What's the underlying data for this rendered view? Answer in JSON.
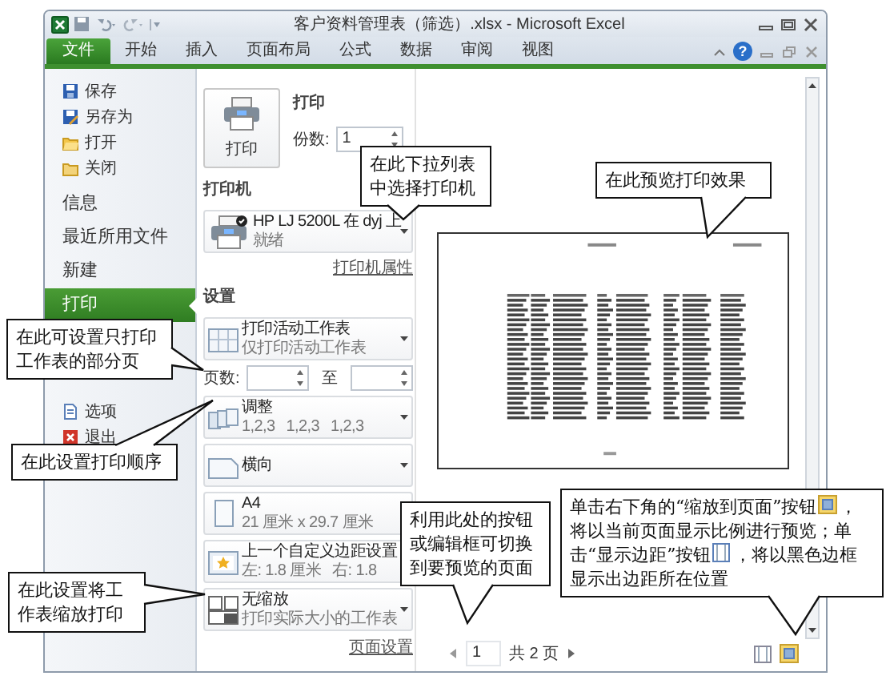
{
  "window": {
    "title": "客户资料管理表（筛选）.xlsx - Microsoft Excel"
  },
  "ribbon": {
    "tabs": [
      {
        "label": "文件",
        "selected": true
      },
      {
        "label": "开始",
        "selected": false
      },
      {
        "label": "插入",
        "selected": false
      },
      {
        "label": "页面布局",
        "selected": false
      },
      {
        "label": "公式",
        "selected": false
      },
      {
        "label": "数据",
        "selected": false
      },
      {
        "label": "审阅",
        "selected": false
      },
      {
        "label": "视图",
        "selected": false
      }
    ],
    "help": "?"
  },
  "sidebar": {
    "groups": [
      [
        {
          "label": "保存",
          "kind": "command",
          "selected": false
        },
        {
          "label": "另存为",
          "kind": "command",
          "selected": false
        },
        {
          "label": "打开",
          "kind": "command",
          "selected": false
        },
        {
          "label": "关闭",
          "kind": "command",
          "selected": false
        }
      ],
      [
        {
          "label": "信息",
          "kind": "section",
          "selected": false
        },
        {
          "label": "最近所用文件",
          "kind": "section",
          "selected": false
        },
        {
          "label": "新建",
          "kind": "section",
          "selected": false
        },
        {
          "label": "打印",
          "kind": "section",
          "selected": true
        }
      ],
      [
        {
          "label": "选项",
          "kind": "command",
          "selected": false
        },
        {
          "label": "退出",
          "kind": "command",
          "selected": false
        }
      ]
    ]
  },
  "print": {
    "button": "打印",
    "heading": "打印",
    "copies_label": "份数:",
    "copies": "1"
  },
  "printer": {
    "heading": "打印机",
    "name": "HP LJ 5200L 在 dyj 上",
    "status": "就绪",
    "properties_link": "打印机属性"
  },
  "settings": {
    "heading": "设置",
    "items": [
      {
        "kind": "dropdown",
        "title": "打印活动工作表",
        "subtitles": [
          "仅打印活动工作表"
        ]
      },
      {
        "kind": "range",
        "label": "页数:",
        "to_label": "至"
      },
      {
        "kind": "dropdown",
        "title": "调整",
        "subtitles": [
          "1,2,3",
          "1,2,3",
          "1,2,3"
        ]
      },
      {
        "kind": "dropdown",
        "title": "横向"
      },
      {
        "kind": "dropdown",
        "title": "A4",
        "subtitles": [
          "21 厘米 x 29.7 厘米"
        ]
      },
      {
        "kind": "dropdown",
        "title": "上一个自定义边距设置",
        "subtitles": [
          "左: 1.8 厘米",
          "右: 1.8"
        ]
      },
      {
        "kind": "dropdown",
        "title": "无缩放",
        "subtitles": [
          "打印实际大小的工作表"
        ]
      }
    ],
    "page_setup_link": "页面设置"
  },
  "preview": {
    "current_page": "1",
    "total": "共 2 页"
  },
  "callouts": [
    {
      "lines": [
        "在此下拉列表",
        "中选择打印机"
      ]
    },
    {
      "lines": [
        "在此预览打印效果"
      ]
    },
    {
      "lines": [
        "在此可设置只打印",
        "工作表的部分页"
      ]
    },
    {
      "lines": [
        "在此设置打印顺序"
      ]
    },
    {
      "lines": [
        "利用此处的按钮",
        "或编辑框可切换",
        "到要预览的页面"
      ]
    },
    {
      "parts": [
        {
          "kind": "text",
          "text": "单击右下角的“缩放到页面”按钮"
        },
        {
          "kind": "icon"
        },
        {
          "kind": "text",
          "text": "，将以当前页面显示比例进行预览；单击“显示边距”按钮"
        },
        {
          "kind": "icon"
        },
        {
          "kind": "text",
          "text": "，将以黑色边框显示出边距所在位置"
        }
      ]
    },
    {
      "lines": [
        "在此设置将工",
        "作表缩放打印"
      ]
    }
  ]
}
